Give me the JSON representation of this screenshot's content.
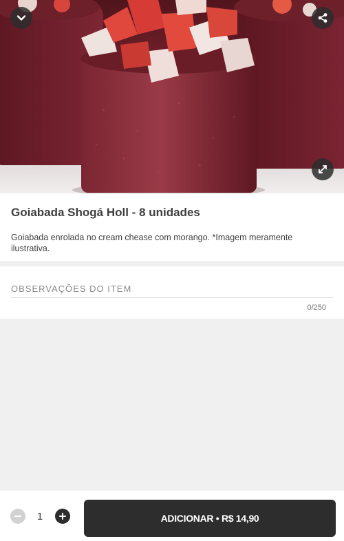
{
  "product": {
    "title": "Goiabada Shogá Holl - 8 unidades",
    "description": "Goiabada enrolada no cream chease com morango. *Imagem meramente ilustrativa."
  },
  "hero": {
    "image_alt": "Goiabada Shogá Holl",
    "buttons": {
      "close_icon": "chevron-down-icon",
      "share_icon": "share-icon",
      "expand_icon": "expand-icon"
    }
  },
  "notes": {
    "label": "OBSERVAÇÕES DO ITEM",
    "counter": "0/250"
  },
  "footer": {
    "quantity": "1",
    "add_label": "ADICIONAR • R$ 14,90",
    "minus_icon": "minus-icon",
    "plus_icon": "plus-icon"
  },
  "colors": {
    "dark": "#2d2d2d",
    "text": "#3e3e3e",
    "muted": "#8a8a8a",
    "background": "#f0f0f0"
  }
}
